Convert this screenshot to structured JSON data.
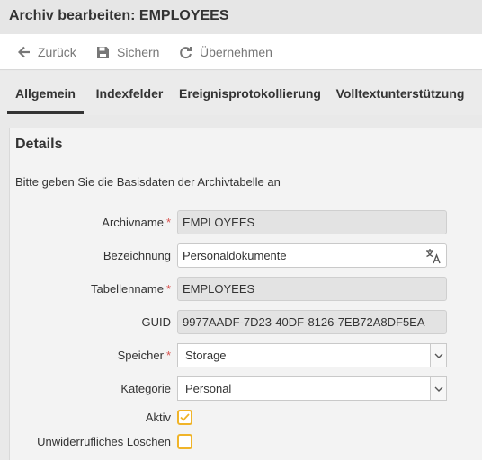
{
  "header": {
    "title": "Archiv bearbeiten: EMPLOYEES"
  },
  "toolbar": {
    "back_label": "Zurück",
    "save_label": "Sichern",
    "apply_label": "Übernehmen"
  },
  "tabs": [
    {
      "label": "Allgemein",
      "active": true
    },
    {
      "label": "Indexfelder",
      "active": false
    },
    {
      "label": "Ereignisprotokollierung",
      "active": false
    },
    {
      "label": "Volltextunterstützung",
      "active": false
    }
  ],
  "details": {
    "heading": "Details",
    "intro": "Bitte geben Sie die Basisdaten der Archivtabelle an",
    "archivname": {
      "label": "Archivname",
      "value": "EMPLOYEES",
      "required": true
    },
    "bezeichnung": {
      "label": "Bezeichnung",
      "value": "Personaldokumente"
    },
    "tabellenname": {
      "label": "Tabellenname",
      "value": "EMPLOYEES",
      "required": true
    },
    "guid": {
      "label": "GUID",
      "value": "9977AADF-7D23-40DF-8126-7EB72A8DF5EA"
    },
    "speicher": {
      "label": "Speicher",
      "value": "Storage",
      "required": true
    },
    "kategorie": {
      "label": "Kategorie",
      "value": "Personal"
    },
    "aktiv": {
      "label": "Aktiv",
      "checked": true
    },
    "loeschen": {
      "label": "Unwiderrufliches Löschen",
      "checked": false
    },
    "required_marker": "*"
  },
  "colors": {
    "accent": "#f0b429",
    "required": "#d9534f"
  }
}
